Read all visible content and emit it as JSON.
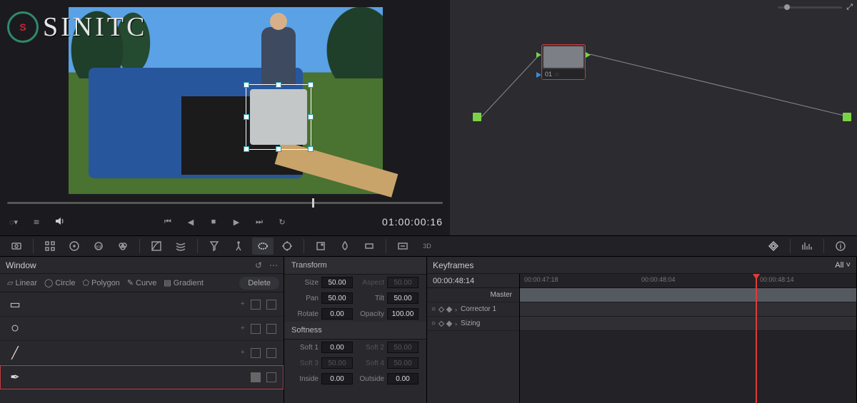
{
  "watermark": "SINITC",
  "viewer": {
    "timecode": "01:00:00:16"
  },
  "node": {
    "label": "01"
  },
  "toolbar_icons": [
    "camera-raw",
    "gallery",
    "wheels",
    "hdr",
    "mixer",
    "curves",
    "warper",
    "qualifier",
    "tracker",
    "window",
    "blur",
    "key",
    "sizing",
    "lut",
    "alpha",
    "stereo-3d"
  ],
  "toolbar_right": [
    "effects",
    "scopes",
    "info"
  ],
  "window_panel": {
    "title": "Window",
    "tools_labels": {
      "linear": "Linear",
      "circle": "Circle",
      "polygon": "Polygon",
      "curve": "Curve",
      "gradient": "Gradient"
    },
    "delete": "Delete",
    "shapes": [
      "rect",
      "circle",
      "line",
      "pen"
    ],
    "selected": 3
  },
  "transform": {
    "title": "Transform",
    "size": {
      "label": "Size",
      "value": "50.00"
    },
    "aspect": {
      "label": "Aspect",
      "value": "50.00"
    },
    "pan": {
      "label": "Pan",
      "value": "50.00"
    },
    "tilt": {
      "label": "Tilt",
      "value": "50.00"
    },
    "rotate": {
      "label": "Rotate",
      "value": "0.00"
    },
    "opacity": {
      "label": "Opacity",
      "value": "100.00"
    },
    "softness_title": "Softness",
    "soft1": {
      "label": "Soft 1",
      "value": "0.00"
    },
    "soft2": {
      "label": "Soft 2",
      "value": "50.00"
    },
    "soft3": {
      "label": "Soft 3",
      "value": "50.00"
    },
    "soft4": {
      "label": "Soft 4",
      "value": "50.00"
    },
    "inside": {
      "label": "Inside",
      "value": "0.00"
    },
    "outside": {
      "label": "Outside",
      "value": "0.00"
    }
  },
  "keyframes": {
    "title": "Keyframes",
    "mode": "All",
    "timecode": "00:00:48:14",
    "ruler": {
      "t1": "00:00:47:18",
      "t2": "00:00:48:04",
      "t3": "00:00:48:14"
    },
    "rows": {
      "master": "Master",
      "c1": "Corrector 1",
      "sizing": "Sizing"
    }
  }
}
